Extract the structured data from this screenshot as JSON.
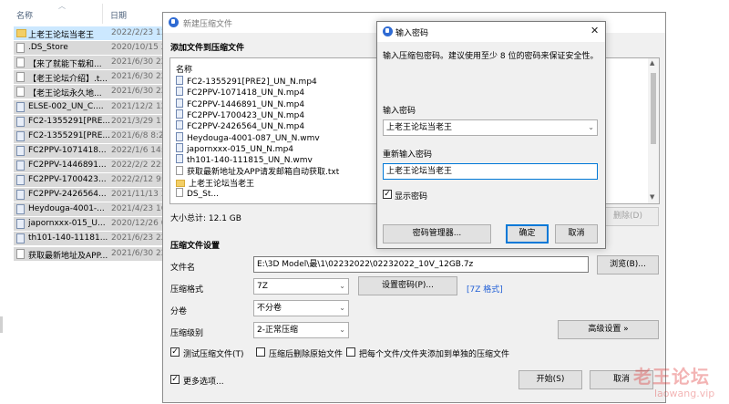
{
  "explorer": {
    "columns": {
      "name": "名称",
      "date": "日期"
    },
    "rows": [
      {
        "name": "上老王论坛当老王",
        "date": "2022/2/23 13:4",
        "icon": "folder"
      },
      {
        "name": ".DS_Store",
        "date": "2020/10/15 23:",
        "icon": "file"
      },
      {
        "name": "【来了就能下载和...",
        "date": "2021/6/30 22:",
        "icon": "file"
      },
      {
        "name": "【老王论坛介绍】.t...",
        "date": "2021/6/30 22:",
        "icon": "file"
      },
      {
        "name": "【老王论坛永久地...",
        "date": "2021/6/30 22:",
        "icon": "file"
      },
      {
        "name": "ELSE-002_UN_C....",
        "date": "2021/12/2 12:",
        "icon": "media"
      },
      {
        "name": "FC2-1355291[PRE...",
        "date": "2021/3/29 17:",
        "icon": "media"
      },
      {
        "name": "FC2-1355291[PRE...",
        "date": "2021/6/8 8:21",
        "icon": "media"
      },
      {
        "name": "FC2PPV-1071418...",
        "date": "2022/1/6 14:4",
        "icon": "media"
      },
      {
        "name": "FC2PPV-1446891...",
        "date": "2022/2/2 22:4",
        "icon": "media"
      },
      {
        "name": "FC2PPV-1700423...",
        "date": "2022/2/12 9:5",
        "icon": "media"
      },
      {
        "name": "FC2PPV-2426564...",
        "date": "2021/11/13 3:",
        "icon": "media"
      },
      {
        "name": "Heydouga-4001-...",
        "date": "2021/4/23 16:",
        "icon": "media"
      },
      {
        "name": "japornxxx-015_U...",
        "date": "2020/12/26 0:",
        "icon": "media"
      },
      {
        "name": "th101-140-11181...",
        "date": "2021/6/23 22:",
        "icon": "media"
      },
      {
        "name": "获取最新地址及APP...",
        "date": "2021/6/30 22:",
        "icon": "file"
      }
    ]
  },
  "archive_dialog": {
    "title": "新建压缩文件",
    "add_files_heading": "添加文件到压缩文件",
    "list_header": "名称",
    "files": [
      {
        "name": "FC2-1355291[PRE2]_UN_N.mp4",
        "icon": "media"
      },
      {
        "name": "FC2PPV-1071418_UN_N.mp4",
        "icon": "media"
      },
      {
        "name": "FC2PPV-1446891_UN_N.mp4",
        "icon": "media"
      },
      {
        "name": "FC2PPV-1700423_UN_N.mp4",
        "icon": "media"
      },
      {
        "name": "FC2PPV-2426564_UN_N.mp4",
        "icon": "media"
      },
      {
        "name": "Heydouga-4001-087_UN_N.wmv",
        "icon": "media"
      },
      {
        "name": "japornxxx-015_UN_N.mp4",
        "icon": "media"
      },
      {
        "name": "th101-140-111815_UN_N.wmv",
        "icon": "media"
      },
      {
        "name": "获取最新地址及APP请发邮箱自动获取.txt",
        "icon": "txt"
      },
      {
        "name": "上老王论坛当老王",
        "icon": "folder"
      },
      {
        "name": "DS_St...",
        "icon": "txt"
      }
    ],
    "total_size": "大小总计: 12.1 GB",
    "delete_button": "删除(D)",
    "settings_heading": "压缩文件设置",
    "filename_label": "文件名",
    "filename_value": "E:\\3D Model\\最\\1\\02232022\\02232022_10V_12GB.7z",
    "browse_button": "浏览(B)...",
    "format_label": "压缩格式",
    "format_value": "7Z",
    "set_password_button": "设置密码(P)...",
    "format_link": "[7Z 格式]",
    "split_label": "分卷",
    "split_value": "不分卷",
    "level_label": "压缩级别",
    "level_value": "2-正常压缩",
    "advanced_button": "高级设置 »",
    "test_checkbox": {
      "label": "测试压缩文件(T)",
      "checked": true
    },
    "delete_source_checkbox": {
      "label": "压缩后删除原始文件",
      "checked": false
    },
    "separate_checkbox": {
      "label": "把每个文件/文件夹添加到单独的压缩文件",
      "checked": false
    },
    "more_options_checkbox": {
      "label": "更多选项...",
      "checked": true
    },
    "start_button": "开始(S)",
    "cancel_button": "取消"
  },
  "password_dialog": {
    "title": "输入密码",
    "description": "输入压缩包密码。建议使用至少 8 位的密码来保证安全性。",
    "password_label": "输入密码",
    "password_value": "上老王论坛当老王",
    "confirm_label": "重新输入密码",
    "confirm_value": "上老王论坛当老王",
    "show_password": {
      "label": "显示密码",
      "checked": true
    },
    "manager_button": "密码管理器...",
    "ok_button": "确定",
    "cancel_button": "取消"
  },
  "watermark": {
    "line1": "老王论坛",
    "line2": "laowang.vip"
  },
  "colors": {
    "selection": "#cce8ff",
    "accent": "#0078d7",
    "link": "#1f5ed6",
    "watermark": "#dc2828"
  }
}
